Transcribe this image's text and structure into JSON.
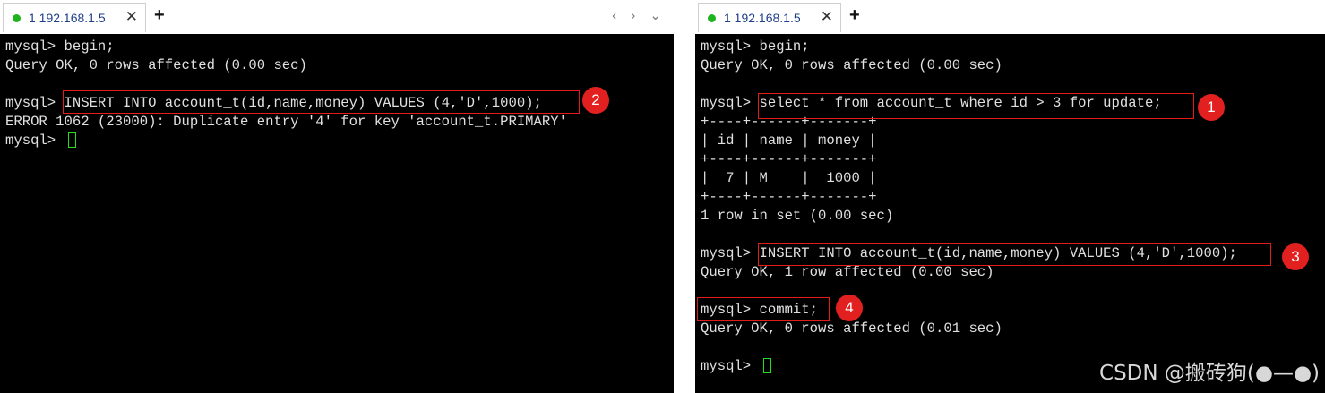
{
  "left": {
    "tab_title": "1 192.168.1.5",
    "close_glyph": "✕",
    "new_tab_glyph": "+",
    "nav_glyphs": "‹ › ⌄",
    "lines": [
      "mysql> begin;",
      "Query OK, 0 rows affected (0.00 sec)",
      "",
      "mysql> INSERT INTO account_t(id,name,money) VALUES (4,'D',1000);",
      "ERROR 1062 (23000): Duplicate entry '4' for key 'account_t.PRIMARY'",
      "mysql> "
    ],
    "badges": [
      "2"
    ]
  },
  "right": {
    "tab_title": "1 192.168.1.5",
    "close_glyph": "✕",
    "new_tab_glyph": "+",
    "lines": [
      "mysql> begin;",
      "Query OK, 0 rows affected (0.00 sec)",
      "",
      "mysql> select * from account_t where id > 3 for update;",
      "+----+------+-------+",
      "| id | name | money |",
      "+----+------+-------+",
      "|  7 | M    |  1000 |",
      "+----+------+-------+",
      "1 row in set (0.00 sec)",
      "",
      "mysql> INSERT INTO account_t(id,name,money) VALUES (4,'D',1000);",
      "Query OK, 1 row affected (0.00 sec)",
      "",
      "mysql> commit;",
      "Query OK, 0 rows affected (0.01 sec)",
      "",
      "mysql> "
    ],
    "badges": [
      "1",
      "3",
      "4"
    ]
  },
  "watermark": "CSDN @搬砖狗(●—●)",
  "colors": {
    "terminal_bg": "#000000",
    "terminal_text": "#e0e0e0",
    "highlight_box": "#e21b1b",
    "badge": "#e32020",
    "cursor": "#22dd22",
    "status_dot": "#1fb31f"
  }
}
